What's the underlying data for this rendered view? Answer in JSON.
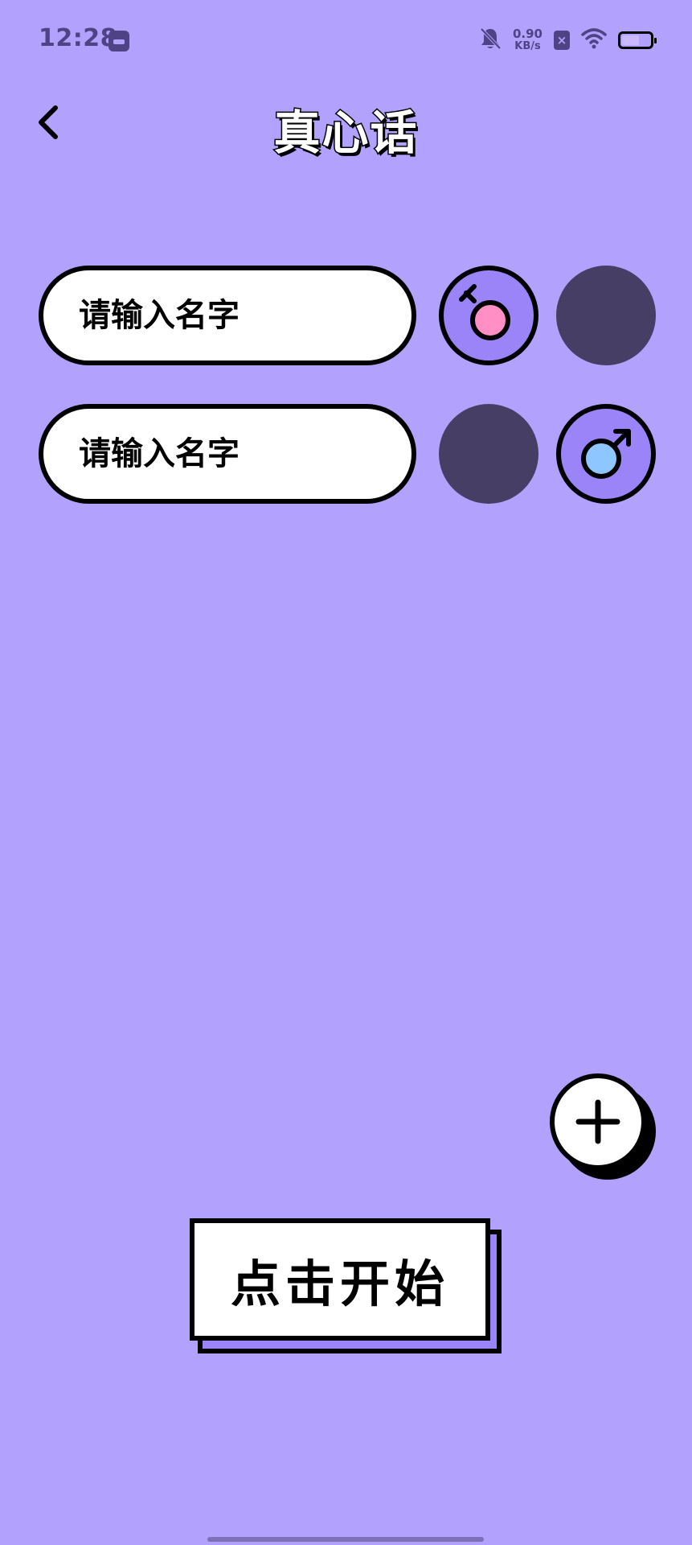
{
  "status_bar": {
    "time": "12:28",
    "net_speed_value": "0.90",
    "net_speed_unit": "KB/s",
    "sim_label": "×",
    "battery_level": 0.55
  },
  "header": {
    "title": "真心话"
  },
  "players": [
    {
      "placeholder": "请输入名字",
      "selected_gender": "female"
    },
    {
      "placeholder": "请输入名字",
      "selected_gender": "male"
    }
  ],
  "actions": {
    "start_label": "点击开始"
  },
  "icons": {
    "back": "back-chevron-icon",
    "female": "female-icon",
    "male": "male-icon",
    "add": "plus-icon",
    "mute": "bell-off-icon",
    "wifi": "wifi-icon",
    "battery": "battery-icon"
  },
  "colors": {
    "background": "#b3a1fe",
    "accent": "#9b83f8",
    "inactive": "#473e66",
    "female": "#ff8fc4",
    "male": "#8ec6ff",
    "status_text": "#4f4385"
  }
}
